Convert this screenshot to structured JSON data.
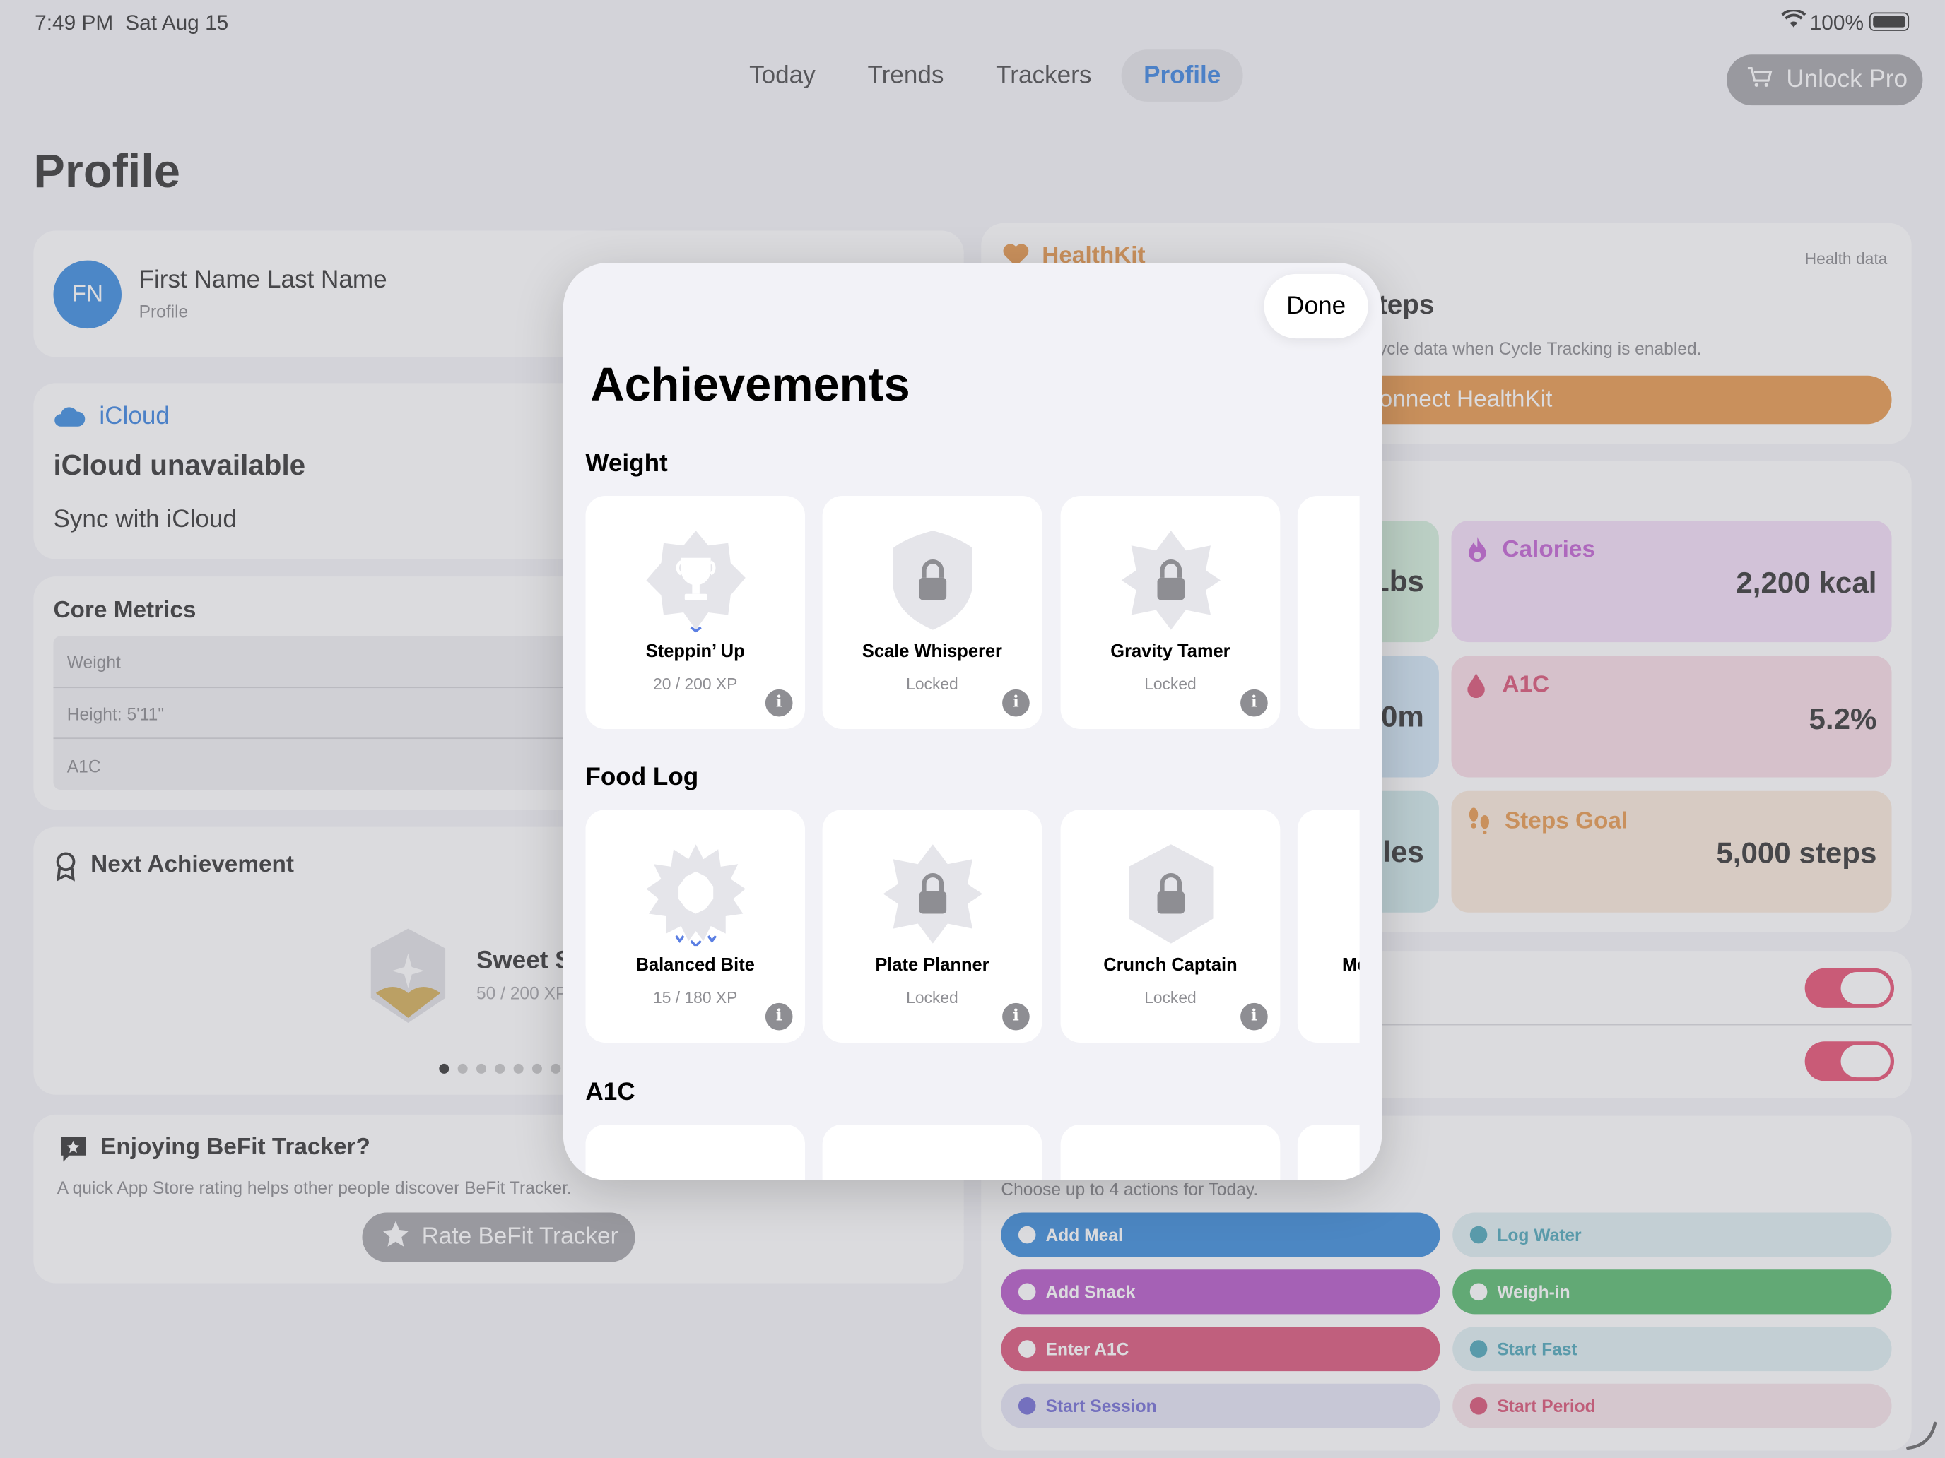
{
  "status": {
    "time": "7:49 PM",
    "date": "Sat Aug 15",
    "battery": "100%"
  },
  "nav": {
    "tabs": [
      {
        "label": "Today"
      },
      {
        "label": "Trends"
      },
      {
        "label": "Trackers"
      },
      {
        "label": "Profile"
      }
    ],
    "active": "Profile",
    "unlock_pro": "Unlock Pro"
  },
  "page_title": "Profile",
  "profile": {
    "initials": "FN",
    "name": "First Name Last Name",
    "subtitle": "Profile"
  },
  "icloud": {
    "title": "iCloud",
    "status": "iCloud unavailable",
    "sync": "Sync with iCloud"
  },
  "core_metrics": {
    "title": "Core Metrics",
    "rows": [
      "Weight",
      "Height: 5'11\"",
      "A1C"
    ]
  },
  "next_achievement": {
    "title": "Next Achievement",
    "name": "Sweet S",
    "xp": "50 / 200 XP"
  },
  "rating": {
    "title": "Enjoying BeFit Tracker?",
    "body": "A quick App Store rating helps other people discover BeFit Tracker.",
    "button": "Rate BeFit Tracker"
  },
  "healthkit": {
    "title": "HealthKit",
    "corner": "Health data",
    "heading": "teps",
    "desc": "ycle data when Cycle Tracking is enabled.",
    "button": "onnect HealthKit"
  },
  "goals": [
    {
      "label": "Calories",
      "value": "2,200 kcal",
      "partial": "Lbs"
    },
    {
      "label": "A1C",
      "value": "5.2%",
      "partial": "0m"
    },
    {
      "label": "Steps Goal",
      "value": "5,000 steps",
      "partial": "les"
    }
  ],
  "quick_actions": {
    "desc": "Choose up to 4 actions for Today.",
    "items": [
      {
        "label": "Add Meal",
        "color": "#0a6fd0",
        "selected": true
      },
      {
        "label": "Log Water",
        "color": "#d6eaee",
        "selected": false
      },
      {
        "label": "Add Snack",
        "color": "#a22eb8",
        "selected": true
      },
      {
        "label": "Weigh-in",
        "color": "#2faa4a",
        "selected": true
      },
      {
        "label": "Enter A1C",
        "color": "#d02a58",
        "selected": true
      },
      {
        "label": "Start Fast",
        "color": "#d6eaee",
        "selected": false
      },
      {
        "label": "Start Session",
        "color": "#dcdcf2",
        "selected": false
      },
      {
        "label": "Start Period",
        "color": "#f4dde3",
        "selected": false
      }
    ]
  },
  "modal": {
    "done": "Done",
    "title": "Achievements",
    "sections": [
      {
        "title": "Weight",
        "cards": [
          {
            "name": "Steppin’ Up",
            "sub": "20 / 200 XP",
            "icon": "trophy-icon"
          },
          {
            "name": "Scale Whisperer",
            "sub": "Locked",
            "icon": "lock-icon"
          },
          {
            "name": "Gravity Tamer",
            "sub": "Locked",
            "icon": "lock-icon"
          },
          {
            "name": "",
            "sub": "",
            "icon": ""
          }
        ]
      },
      {
        "title": "Food Log",
        "cards": [
          {
            "name": "Balanced Bite",
            "sub": "15 / 180 XP",
            "icon": "burst-icon"
          },
          {
            "name": "Plate Planner",
            "sub": "Locked",
            "icon": "lock-icon"
          },
          {
            "name": "Crunch Captain",
            "sub": "Locked",
            "icon": "lock-icon"
          },
          {
            "name": "Me",
            "sub": "",
            "icon": ""
          }
        ]
      },
      {
        "title": "A1C",
        "cards": []
      }
    ]
  },
  "colors": {
    "accent": "#0a64d8",
    "healthkit": "#e07e1f",
    "calories": "#b13ac6",
    "a1c": "#cf2751",
    "steps": "#e07e1f"
  }
}
